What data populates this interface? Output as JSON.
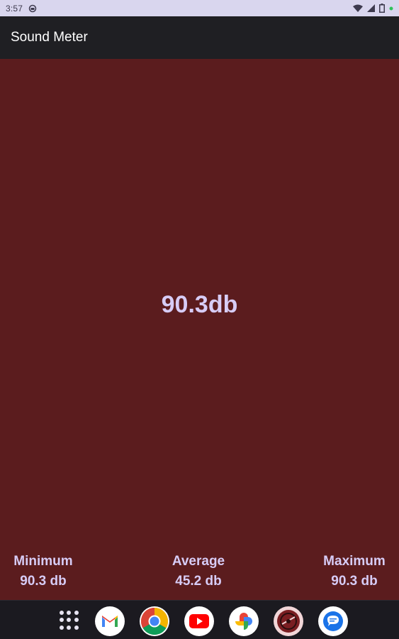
{
  "status_bar": {
    "time": "3:57",
    "icons": [
      "notification-icon",
      "wifi-icon",
      "signal-icon",
      "battery-icon"
    ]
  },
  "app_bar": {
    "title": "Sound Meter"
  },
  "meter": {
    "current_reading": "90.3db",
    "background_color": "#5b1c1e",
    "text_color": "#d7ccf6"
  },
  "stats": {
    "minimum": {
      "label": "Minimum",
      "value": "90.3 db"
    },
    "average": {
      "label": "Average",
      "value": "45.2 db"
    },
    "maximum": {
      "label": "Maximum",
      "value": "90.3 db"
    }
  },
  "dock": {
    "items": [
      "app-drawer-icon",
      "gmail-icon",
      "chrome-icon",
      "youtube-icon",
      "photos-icon",
      "sound-app-icon",
      "messages-icon"
    ]
  }
}
